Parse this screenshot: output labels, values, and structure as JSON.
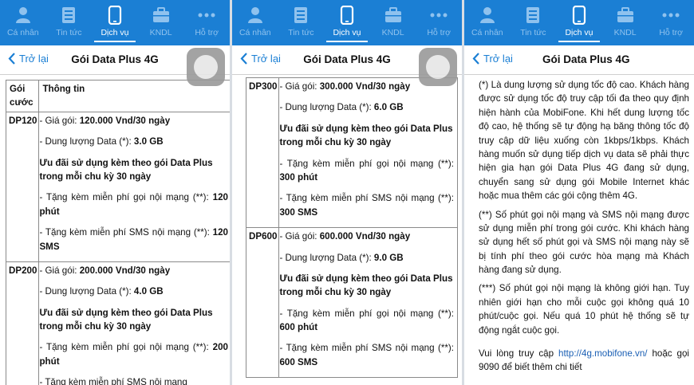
{
  "tabs": [
    {
      "label": "Cá nhân",
      "icon": "person-icon",
      "active": false
    },
    {
      "label": "Tin tức",
      "icon": "news-icon",
      "active": false
    },
    {
      "label": "Dịch vụ",
      "icon": "phone-icon",
      "active": true
    },
    {
      "label": "KNDL",
      "icon": "briefcase-icon",
      "active": false
    },
    {
      "label": "Hỗ trợ",
      "icon": "more-icon",
      "active": false
    }
  ],
  "nav": {
    "back_label": "Trở lại",
    "title": "Gói Data Plus 4G"
  },
  "colors": {
    "accent": "#1b7fd4",
    "link": "#1a5fb4"
  },
  "table": {
    "header_code": "Gói cước",
    "header_info": "Thông tin"
  },
  "packages": [
    {
      "code": "DP120",
      "price_prefix": "- Giá gói: ",
      "price": "120.000 Vnd/30 ngày",
      "data_prefix": "- Dung lượng Data (*): ",
      "data": "3.0 GB",
      "offer": "Ưu đãi sử dụng kèm theo gói Data Plus trong mỗi chu kỳ 30 ngày",
      "calls_prefix": "- Tặng kèm miễn phí gọi nội mạng (**): ",
      "calls": "120 phút",
      "sms_prefix": "- Tặng kèm miễn phí SMS nội mạng (**): ",
      "sms": "120 SMS"
    },
    {
      "code": "DP200",
      "price_prefix": "- Giá gói: ",
      "price": "200.000 Vnd/30 ngày",
      "data_prefix": "- Dung lượng Data (*): ",
      "data": "4.0 GB",
      "offer": "Ưu đãi sử dụng kèm theo gói Data Plus trong mỗi chu kỳ 30 ngày",
      "calls_prefix": "- Tặng kèm miễn phí gọi nội mạng (**): ",
      "calls": "200 phút",
      "sms_prefix": "- Tặng kèm miễn phí SMS nội mạng",
      "sms": ""
    },
    {
      "code": "DP300",
      "price_prefix": "- Giá gói: ",
      "price": "300.000 Vnd/30 ngày",
      "data_prefix": "- Dung lượng Data (*): ",
      "data": "6.0 GB",
      "offer": "Ưu đãi sử dụng kèm theo gói Data Plus trong mỗi chu kỳ 30 ngày",
      "calls_prefix": "- Tặng kèm miễn phí gọi nội mạng (**): ",
      "calls": "300 phút",
      "sms_prefix": "- Tặng kèm miễn phí SMS nội mạng (**): ",
      "sms": "300 SMS"
    },
    {
      "code": "DP600",
      "price_prefix": "- Giá gói: ",
      "price": "600.000 Vnd/30 ngày",
      "data_prefix": "- Dung lượng Data (*): ",
      "data": "9.0 GB",
      "offer": "Ưu đãi sử dụng kèm theo gói Data Plus trong mỗi chu kỳ 30 ngày",
      "calls_prefix": "- Tặng kèm miễn phí gọi nội mạng (**): ",
      "calls": "600 phút",
      "sms_prefix": "- Tặng kèm miễn phí SMS nội mạng (**): ",
      "sms": "600 SMS"
    }
  ],
  "notes": {
    "note1": "(*) Là dung lượng sử dụng tốc độ cao. Khách hàng được sử dụng tốc độ truy cập tối đa theo quy định hiện hành của MobiFone. Khi hết dung lượng tốc độ cao, hệ thống sẽ tự động hạ băng thông tốc độ truy cập dữ liệu xuống còn 1kbps/1kbps. Khách hàng muốn sử dụng tiếp dịch vụ data sẽ phải thực hiện gia hạn gói Data Plus 4G đang sử dụng, chuyển sang sử dụng gói Mobile Internet khác hoặc mua thêm các gói cộng thêm 4G.",
    "note2": "(**) Số phút gọi nội mạng và SMS nội mạng được sử dụng miễn phí trong gói cước. Khi khách hàng sử dụng hết số phút gọi và SMS nội mạng này sẽ bị tính phí theo gói cước hòa mạng mà Khách hàng đang sử dụng.",
    "note3": "(***) Số phút gọi nội mạng là không giới hạn. Tuy nhiên giới hạn cho mỗi cuộc gọi không quá 10 phút/cuộc gọi. Nếu quá 10 phút hệ thống sẽ tự động ngắt cuộc gọi.",
    "footer_prefix": "Vui lòng truy cập ",
    "footer_link": "http://4g.mobifone.vn/",
    "footer_suffix": " hoặc gọi 9090 để biết thêm chi tiết"
  }
}
